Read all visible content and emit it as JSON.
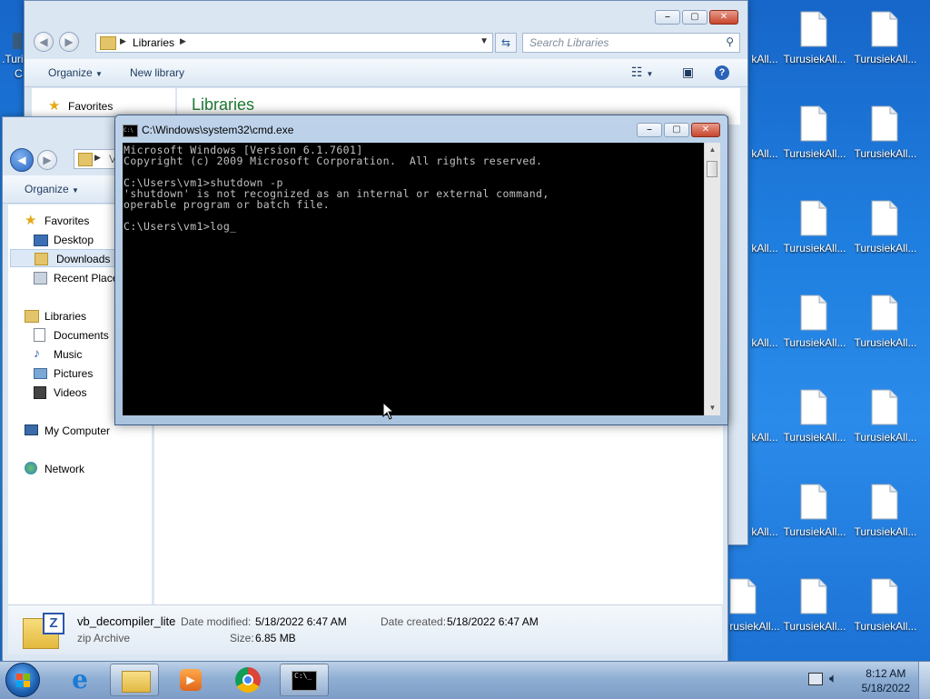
{
  "desktop": {
    "left_icon_label_1": ".Turi",
    "left_icon_label_2": "C",
    "icons": [
      {
        "label": "TurusiekAll...",
        "partial": "kAll..."
      },
      {
        "label": "TurusiekAll..."
      },
      {
        "label": "rusiekAll..."
      }
    ]
  },
  "back_explorer": {
    "address_crumb": "Libraries",
    "search_placeholder": "Search Libraries",
    "toolbar": {
      "organize": "Organize",
      "new_library": "New library"
    },
    "nav_favorites": "Favorites",
    "content_heading": "Libraries"
  },
  "front_explorer": {
    "address_crumb": "V",
    "toolbar": {
      "organize": "Organize"
    },
    "nav": {
      "favorites": "Favorites",
      "desktop": "Desktop",
      "downloads": "Downloads",
      "recent_places": "Recent Places",
      "libraries": "Libraries",
      "documents": "Documents",
      "music": "Music",
      "pictures": "Pictures",
      "videos": "Videos",
      "my_computer": "My Computer",
      "network": "Network"
    },
    "details": {
      "file_name": "vb_decompiler_lite",
      "file_type": "zip Archive",
      "date_modified_label": "Date modified:",
      "date_modified": "5/18/2022 6:47 AM",
      "date_created_label": "Date created:",
      "date_created": "5/18/2022 6:47 AM",
      "size_label": "Size:",
      "size": "6.85 MB"
    }
  },
  "cmd": {
    "title": "C:\\Windows\\system32\\cmd.exe",
    "lines": [
      "Microsoft Windows [Version 6.1.7601]",
      "Copyright (c) 2009 Microsoft Corporation.  All rights reserved.",
      "",
      "C:\\Users\\vm1>shutdown -p",
      "'shutdown' is not recognized as an internal or external command,",
      "operable program or batch file.",
      "",
      "C:\\Users\\vm1>log_"
    ]
  },
  "taskbar": {
    "time": "8:12 AM",
    "date": "5/18/2022"
  },
  "colors": {
    "desktop_blue": "#1f7fe0",
    "explorer_heading_green": "#1e7b34",
    "console_bg": "#000000",
    "console_fg": "#c0c0c0"
  }
}
